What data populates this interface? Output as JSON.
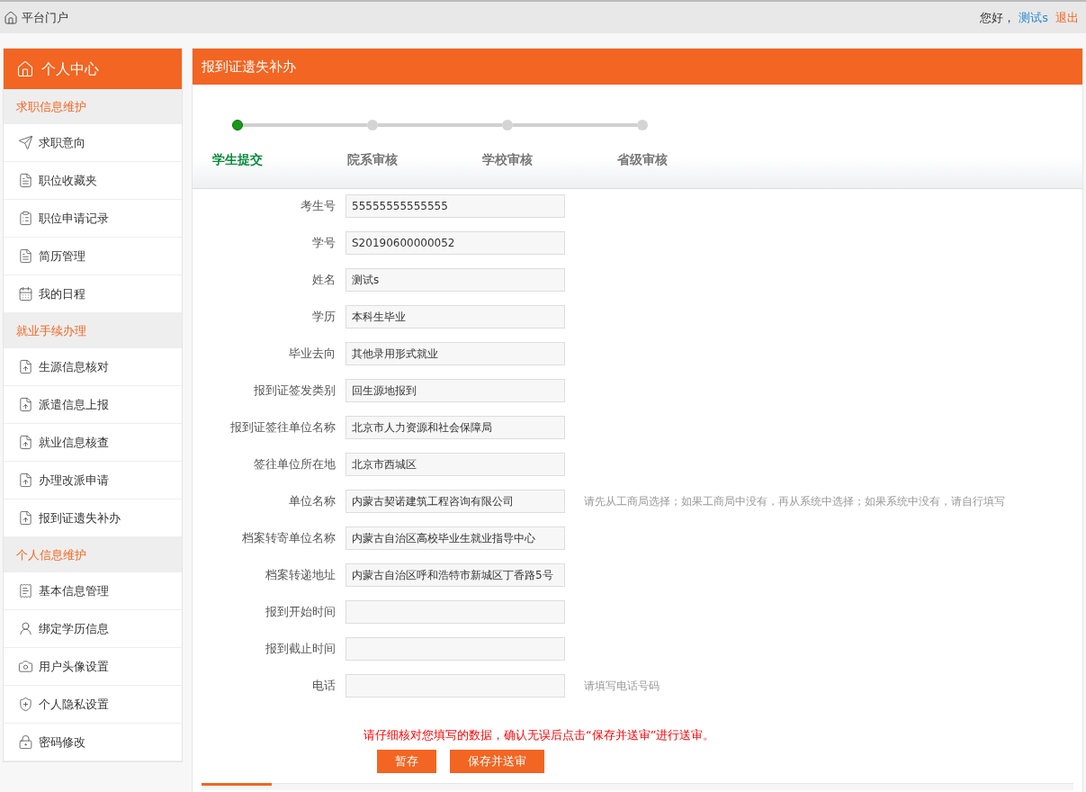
{
  "topbar": {
    "portal": "平台门户",
    "greeting": "您好，",
    "user": "测试s",
    "logout": "退出"
  },
  "sidebar": {
    "title": "个人中心",
    "groups": [
      {
        "title": "求职信息维护",
        "items": [
          {
            "label": "求职意向",
            "selected": false
          },
          {
            "label": "职位收藏夹",
            "selected": false
          },
          {
            "label": "职位申请记录",
            "selected": false
          },
          {
            "label": "简历管理",
            "selected": false
          },
          {
            "label": "我的日程",
            "selected": false
          }
        ]
      },
      {
        "title": "就业手续办理",
        "items": [
          {
            "label": "生源信息核对",
            "selected": false
          },
          {
            "label": "派遣信息上报",
            "selected": false
          },
          {
            "label": "就业信息核查",
            "selected": false
          },
          {
            "label": "办理改派申请",
            "selected": false
          },
          {
            "label": "报到证遗失补办",
            "selected": false
          }
        ]
      },
      {
        "title": "个人信息维护",
        "items": [
          {
            "label": "基本信息管理",
            "selected": false
          },
          {
            "label": "绑定学历信息",
            "selected": false
          },
          {
            "label": "用户头像设置",
            "selected": false
          },
          {
            "label": "个人隐私设置",
            "selected": false
          },
          {
            "label": "密码修改",
            "selected": false
          }
        ]
      }
    ]
  },
  "panel": {
    "title": "报到证遗失补办",
    "steps": [
      {
        "label": "学生提交",
        "selected": true
      },
      {
        "label": "院系审核",
        "selected": false
      },
      {
        "label": "学校审核",
        "selected": false
      },
      {
        "label": "省级审核",
        "selected": false
      }
    ],
    "fields": [
      {
        "label": "考生号",
        "value": "55555555555555"
      },
      {
        "label": "学号",
        "value": "S20190600000052"
      },
      {
        "label": "姓名",
        "value": "测试s"
      },
      {
        "label": "学历",
        "value": "本科生毕业"
      },
      {
        "label": "毕业去向",
        "value": "其他录用形式就业"
      },
      {
        "label": "报到证签发类别",
        "value": "回生源地报到"
      },
      {
        "label": "报到证签往单位名称",
        "value": "北京市人力资源和社会保障局"
      },
      {
        "label": "签往单位所在地",
        "value": "北京市西城区"
      },
      {
        "label": "单位名称",
        "value": "内蒙古契诺建筑工程咨询有限公司",
        "hint": "请先从工商局选择；如果工商局中没有，再从系统中选择；如果系统中没有，请自行填写"
      },
      {
        "label": "档案转寄单位名称",
        "value": "内蒙古自治区高校毕业生就业指导中心"
      },
      {
        "label": "档案转递地址",
        "value": "内蒙古自治区呼和浩特市新城区丁香路5号"
      },
      {
        "label": "报到开始时间"
      },
      {
        "label": "报到截止时间"
      },
      {
        "label": "电话",
        "hint": "请填写电话号码"
      }
    ],
    "notice": "请仔细核对您填写的数据，确认无误后点击“保存并送审”进行送审。",
    "buttons": [
      "暂存",
      "保存并送审"
    ]
  }
}
